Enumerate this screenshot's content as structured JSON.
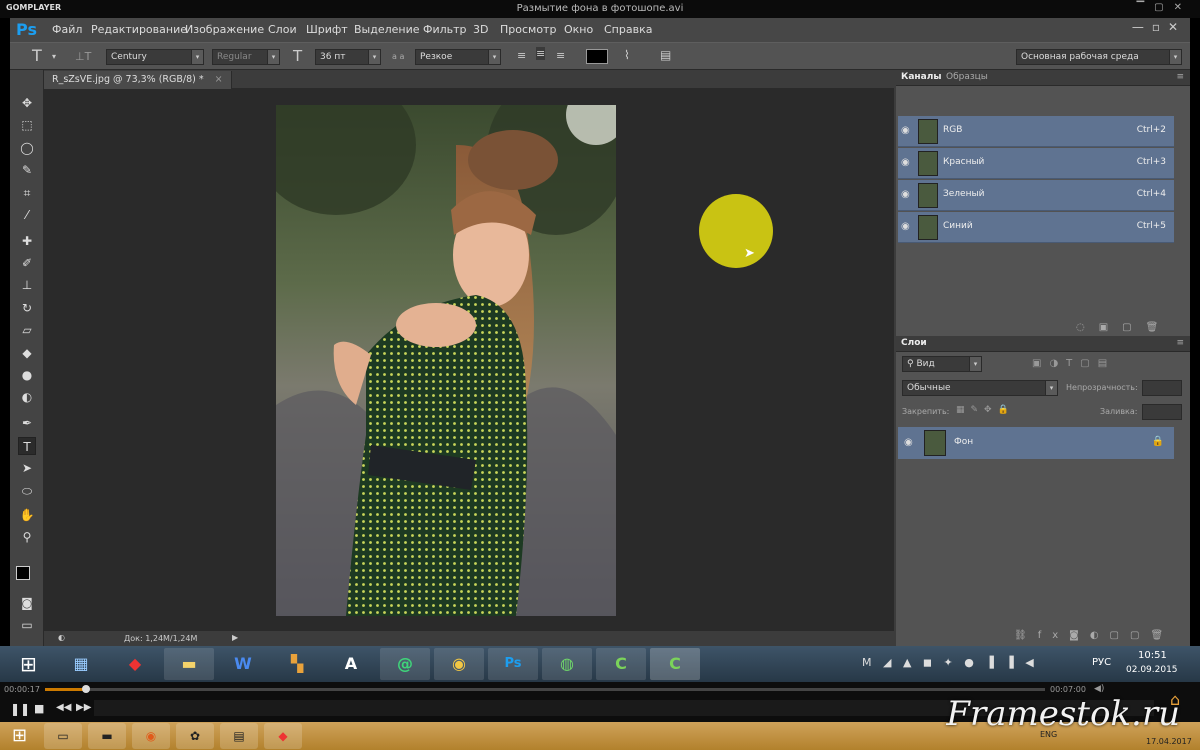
{
  "player": {
    "logo": "GOMPLAYER",
    "window_title": "Размытие фона в фотошопе.avi",
    "time_elapsed": "00:00:17",
    "time_total": "00:07:00",
    "watermark": "Framestok.ru",
    "desktop_date": "17.04.2017"
  },
  "ps": {
    "logo": "Ps",
    "menu": [
      "Файл",
      "Редактирование",
      "Изображение",
      "Слои",
      "Шрифт",
      "Выделение",
      "Фильтр",
      "3D",
      "Просмотр",
      "Окно",
      "Справка"
    ],
    "options": {
      "font_family": "Century",
      "font_style": "Regular",
      "font_size": "36 пт",
      "aa_label": "a a",
      "antialias": "Резкое",
      "workspace": "Основная рабочая среда",
      "text_color": "#000000"
    },
    "document_tab": "R_sZsVE.jpg @ 73,3% (RGB/8) *",
    "status_doc": "Док: 1,24M/1,24M",
    "channels_panel": {
      "tabs": [
        "Каналы",
        "Образцы"
      ],
      "rows": [
        {
          "name": "RGB",
          "shortcut": "Ctrl+2"
        },
        {
          "name": "Красный",
          "shortcut": "Ctrl+3"
        },
        {
          "name": "Зеленый",
          "shortcut": "Ctrl+4"
        },
        {
          "name": "Синий",
          "shortcut": "Ctrl+5"
        }
      ]
    },
    "layers_panel": {
      "tab": "Слои",
      "kind_filter": "Вид",
      "blend_mode": "Обычные",
      "opacity_label": "Непрозрачность:",
      "lock_label": "Закрепить:",
      "fill_label": "Заливка:",
      "layer_name": "Фон"
    }
  },
  "taskbar": {
    "language": "РУС",
    "time": "10:51",
    "date": "02.09.2015",
    "tray_lang": "ENG"
  },
  "colors": {
    "selection_blue": "#5f7391",
    "ps_blue": "#1c9ef0",
    "cursor_highlight": "#c9c313"
  }
}
